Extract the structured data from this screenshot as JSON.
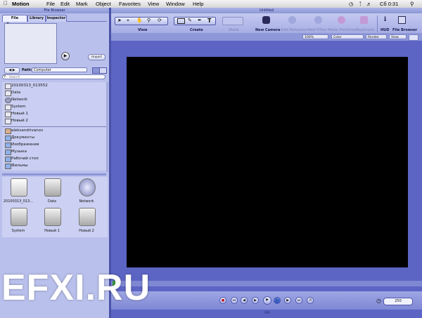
{
  "menubar": {
    "app_name": "Motion",
    "items": [
      "File",
      "Edit",
      "Mark",
      "Object",
      "Favorites",
      "View",
      "Window",
      "Help"
    ],
    "clock": "Сб 0:31"
  },
  "browser": {
    "title": "File Browser",
    "tabs": [
      "File Browser",
      "Library",
      "Inspector"
    ],
    "import_label": "Import",
    "path_label": "Path:",
    "path_value": "Computer",
    "search_placeholder": "Search",
    "volumes": [
      "20100313_013552",
      "Data",
      "Network",
      "System",
      "Новый 1",
      "Новый 2"
    ],
    "places": [
      "aleksandrivanov",
      "Документы",
      "Изображения",
      "Музыка",
      "Рабочий стол",
      "Фильмы"
    ],
    "drives": [
      "20100313_013...",
      "Data",
      "Network",
      "System",
      "Новый 1",
      "Новый 2"
    ]
  },
  "canvas": {
    "title": "Untitled",
    "toolbar_groups": [
      "View",
      "Create",
      "Mask"
    ],
    "actions": [
      "New Camera",
      "Add Behavior",
      "Add Filter",
      "Make Particles",
      "Replicate"
    ],
    "hud_label": "HUD",
    "file_browser_label": "File Browser",
    "zoom": "100%",
    "color_mode": "Color",
    "render": "Render",
    "view": "View",
    "frame": "250"
  },
  "watermark": "EFXI.RU",
  "colors": {
    "panel_bg": "#5c64c4",
    "browser_bg": "#b9c0ec",
    "viewer_bg": "#000000"
  }
}
